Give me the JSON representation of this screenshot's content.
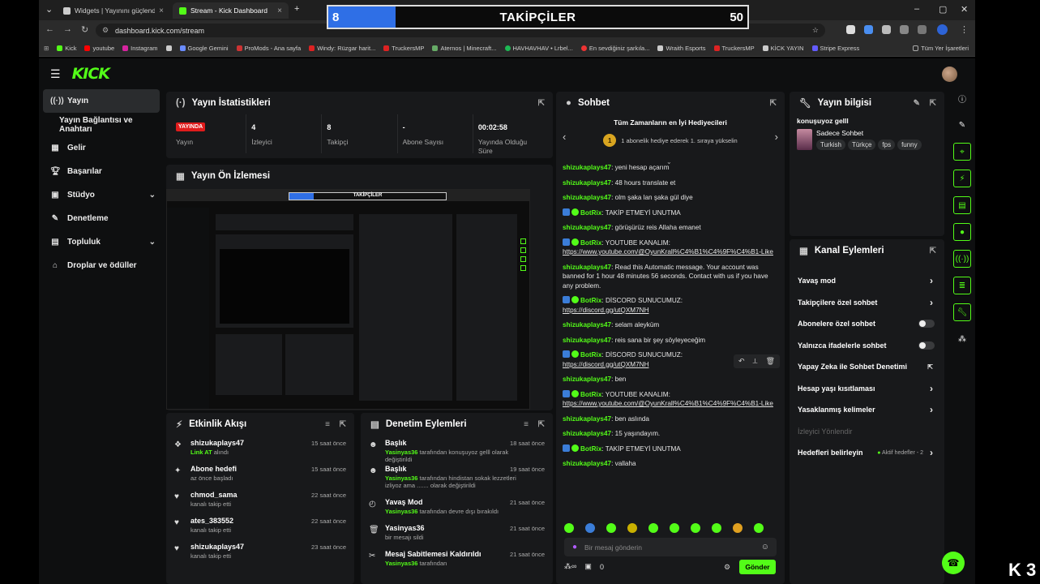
{
  "browser": {
    "tabs": [
      {
        "title": "Widgets | Yayınını güçlendirme"
      },
      {
        "title": "Stream - Kick Dashboard"
      }
    ],
    "url": "dashboard.kick.com/stream",
    "bookmarks": [
      "Kick",
      "youtube",
      "Instagram",
      "Google Gemini",
      "ProMods - Ana sayfa",
      "Windy: Rüzgar harit...",
      "TruckersMP",
      "Aternos | Minecraft...",
      "HAVHAVHAV • Lrbel...",
      "En sevdiğiniz şarkıla...",
      "Wraith Esports",
      "TruckersMP",
      "KİCK YAYIN",
      "Stripe Express"
    ],
    "all_bookmarks": "Tüm Yer İşaretleri"
  },
  "follower_goal": {
    "title": "TAKİPÇİLER",
    "current": "8",
    "goal": "50",
    "progress": 0.16
  },
  "app": {
    "logo": "KICK",
    "sidebar": [
      {
        "label": "Yayın",
        "icon": "stream-icon",
        "active": true
      },
      {
        "label": "Yayın Bağlantısı ve Anahtarı",
        "icon": "",
        "sub": true
      },
      {
        "label": "Gelir",
        "icon": "revenue-icon"
      },
      {
        "label": "Başarılar",
        "icon": "trophy-icon"
      },
      {
        "label": "Stüdyo",
        "icon": "studio-icon",
        "chevron": true
      },
      {
        "label": "Denetleme",
        "icon": "moderation-icon"
      },
      {
        "label": "Topluluk",
        "icon": "community-icon",
        "chevron": true
      },
      {
        "label": "Droplar ve ödüller",
        "icon": "gift-icon"
      }
    ],
    "stats_panel": {
      "title": "Yayın İstatistikleri",
      "live_badge": "YAYINDA",
      "stats": [
        {
          "value": "",
          "label": "Yayın"
        },
        {
          "value": "4",
          "label": "İzleyici"
        },
        {
          "value": "8",
          "label": "Takipçi"
        },
        {
          "value": "-",
          "label": "Abone Sayısı"
        },
        {
          "value": "00:02:58",
          "label": "Yayında Olduğu Süre"
        }
      ]
    },
    "preview_panel": {
      "title": "Yayın Ön İzlemesi"
    },
    "activity_panel": {
      "title": "Etkinlik Akışı",
      "rows": [
        {
          "name": "shizukaplays47",
          "sub_green": "Link AT",
          "sub": "alındı",
          "time": "15 saat önce"
        },
        {
          "name": "Abone hedefi",
          "sub_green": "",
          "sub": "az önce başladı",
          "time": "15 saat önce"
        },
        {
          "name": "chmod_sama",
          "sub_green": "",
          "sub": "kanalı takip etti",
          "time": "22 saat önce"
        },
        {
          "name": "ates_383552",
          "sub_green": "",
          "sub": "kanalı takip etti",
          "time": "22 saat önce"
        },
        {
          "name": "shizukaplays47",
          "sub_green": "",
          "sub": "kanalı takip etti",
          "time": "23 saat önce"
        }
      ]
    },
    "mod_panel": {
      "title": "Denetim Eylemleri",
      "rows": [
        {
          "name": "Başlık",
          "sub_green": "Yasinyas36",
          "sub": "tarafından konuşuyoz gelll olarak değiştirildi",
          "time": "18 saat önce"
        },
        {
          "name": "Başlık",
          "sub_green": "Yasinyas36",
          "sub": "tarafından hindistan sokak lezzetleri izliyoz ama ....... olarak değiştirildi",
          "time": "19 saat önce"
        },
        {
          "name": "Yavaş Mod",
          "sub_green": "Yasinyas36",
          "sub": "tarafından devre dışı bırakıldı",
          "time": "21 saat önce"
        },
        {
          "name": "Yasinyas36",
          "sub_green": "",
          "sub": "bir mesajı sildi",
          "time": "21 saat önce"
        },
        {
          "name": "Mesaj Sabitlemesi Kaldırıldı",
          "sub_green": "Yasinyas36",
          "sub": "tarafından",
          "time": "21 saat önce"
        }
      ]
    },
    "chat_panel": {
      "title": "Sohbet",
      "gifters_title": "Tüm Zamanların en İyi Hediyecileri",
      "gifters_rank": "1",
      "gifters_text": "1 abonelik hediye ederek 1. sıraya yükselin",
      "messages": [
        {
          "user": "shizukaplays47",
          "text": "yeni hesap açarım"
        },
        {
          "user": "shizukaplays47",
          "text": "48 hours translate et"
        },
        {
          "user": "shizukaplays47",
          "text": "olm şaka lan şaka gül diye"
        },
        {
          "user": "BotRix",
          "bot": true,
          "text": "TAKİP ETMEYİ UNUTMA"
        },
        {
          "user": "shizukaplays47",
          "text": "görüşürüz reis Allaha emanet"
        },
        {
          "user": "BotRix",
          "bot": true,
          "text": "YOUTUBE KANALIM:",
          "link": "https://www.youtube.com/@OyunKrall%C4%B1%C4%9F%C4%B1-Like"
        },
        {
          "user": "shizukaplays47",
          "text": "Read this Automatic message. Your account was banned for 1 hour 48 minutes 56 seconds. Contact with us if you have any problem."
        },
        {
          "user": "BotRix",
          "bot": true,
          "text": "DİSCORD SUNUCUMUZ:",
          "link": "https://discord.gg/utQXM7NH"
        },
        {
          "user": "shizukaplays47",
          "text": "selam aleyküm"
        },
        {
          "user": "shizukaplays47",
          "text": "reis sana bir şey söyleyeceğim"
        },
        {
          "user": "BotRix",
          "bot": true,
          "text": "DİSCORD SUNUCUMUZ:",
          "link": "https://discord.gg/utQXM7NH"
        },
        {
          "user": "shizukaplays47",
          "text": "ben"
        },
        {
          "user": "BotRix",
          "bot": true,
          "text": "YOUTUBE KANALIM:",
          "link": "https://www.youtube.com/@OyunKrall%C4%B1%C4%9F%C4%B1-Like"
        },
        {
          "user": "shizukaplays47",
          "text": "ben aslında"
        },
        {
          "user": "shizukaplays47",
          "text": "15 yaşındayım."
        },
        {
          "user": "BotRix",
          "bot": true,
          "text": "TAKİP ETMEYİ UNUTMA"
        },
        {
          "user": "shizukaplays47",
          "text": "vallaha"
        }
      ],
      "input_placeholder": "Bir mesaj gönderin",
      "points": "0",
      "send_label": "Gönder"
    },
    "stream_info": {
      "title": "Yayın bilgisi",
      "stream_title": "konuşuyoz gelll",
      "category": "Sadece Sohbet",
      "tags": [
        "Turkish",
        "Türkçe",
        "fps",
        "funny"
      ]
    },
    "channel_actions": {
      "title": "Kanal Eylemleri",
      "rows": [
        {
          "label": "Yavaş mod",
          "control": "arrow"
        },
        {
          "label": "Takipçilere özel sohbet",
          "control": "arrow"
        },
        {
          "label": "Abonelere özel sohbet",
          "control": "toggle"
        },
        {
          "label": "Yalnızca ifadelerle sohbet",
          "control": "toggle"
        },
        {
          "label": "Yapay Zeka ile Sohbet Denetimi",
          "control": "external"
        },
        {
          "label": "Hesap yaşı kısıtlaması",
          "control": "arrow"
        },
        {
          "label": "Yasaklanmış kelimeler",
          "control": "arrow"
        },
        {
          "label": "İzleyici Yönlendir",
          "control": "none",
          "dim": true
        },
        {
          "label": "Hedefleri belirleyin",
          "control": "goals",
          "extra": "Aktif hedefler - 2"
        }
      ]
    },
    "preview_mini": {
      "title": "TAKİPÇİLER",
      "current": "8",
      "goal": "50"
    }
  },
  "corner_logo": "K 3",
  "colors": {
    "accent": "#53fc18",
    "live": "#e01c1c",
    "bar": "#2f6fe6"
  }
}
